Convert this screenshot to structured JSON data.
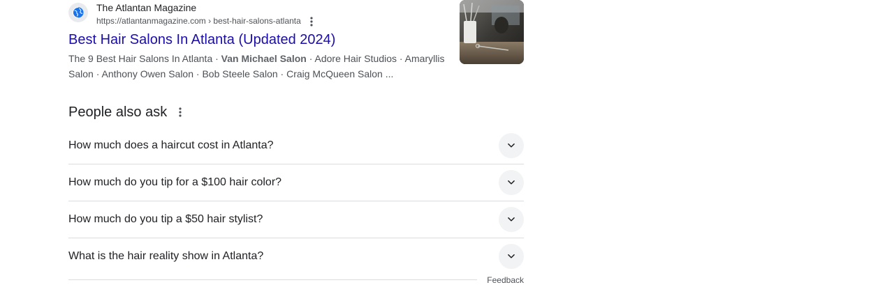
{
  "result": {
    "site_name": "The Atlantan Magazine",
    "site_url": "https://atlantanmagazine.com › best-hair-salons-atlanta",
    "title": "Best Hair Salons In Atlanta (Updated 2024)",
    "snippet_before": "The 9 Best Hair Salons In Atlanta · ",
    "snippet_emphasis": "Van Michael Salon",
    "snippet_after": " · Adore Hair Studios · Amaryllis Salon · Anthony Owen Salon · Bob Steele Salon · Craig McQueen Salon ...",
    "favicon_icon": "globe-icon",
    "more_icon": "three-dots-vertical-icon"
  },
  "people_also_ask": {
    "title": "People also ask",
    "menu_icon": "three-dots-vertical-icon",
    "questions": [
      "How much does a haircut cost in Atlanta?",
      "How much do you tip for a $100 hair color?",
      "How much do you tip a $50 hair stylist?",
      "What is the hair reality show in Atlanta?"
    ],
    "expand_icon": "chevron-down-icon"
  },
  "footer": {
    "feedback_label": "Feedback"
  },
  "colors": {
    "link": "#1a0dab",
    "text": "#202124",
    "secondary_text": "#4d5156",
    "divider": "#dadce0",
    "chevron_bg": "#f1f3f4"
  }
}
